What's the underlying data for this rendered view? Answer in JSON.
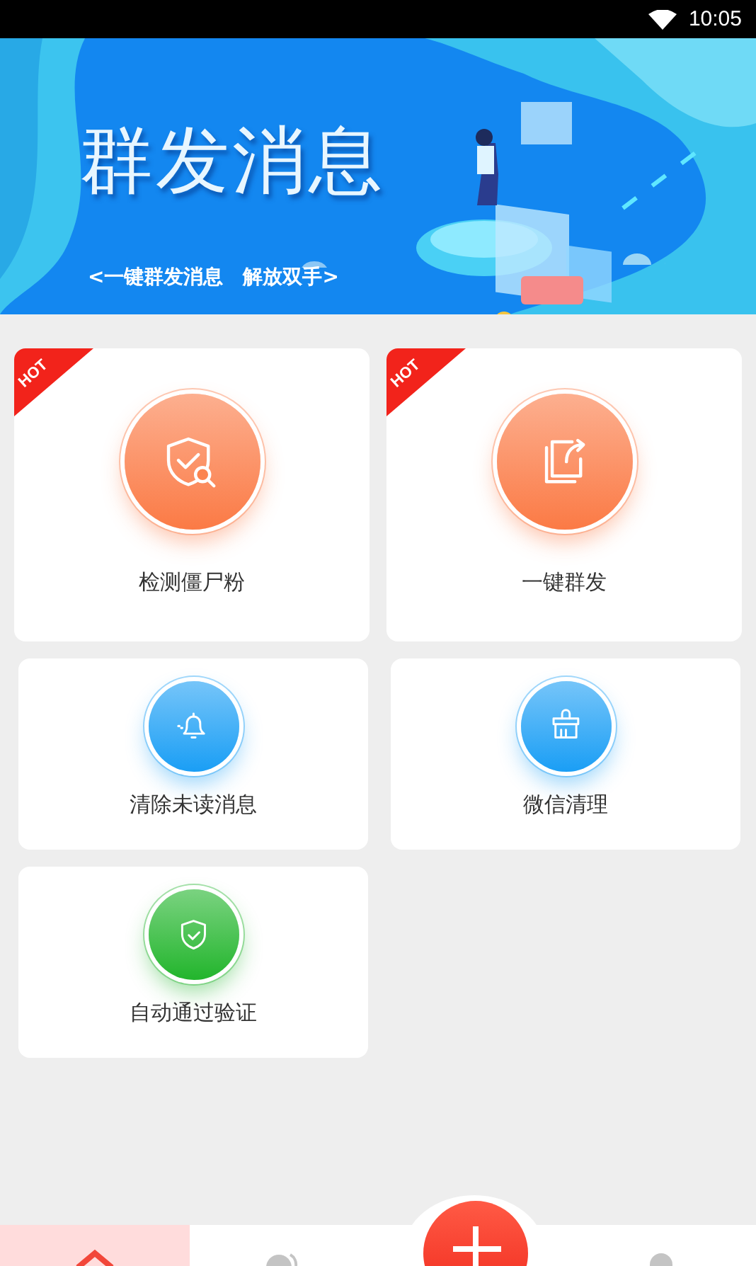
{
  "status_bar": {
    "time": "10:05"
  },
  "banner": {
    "kind": "picture",
    "title": "群发消息",
    "subtitle": "<一键群发消息　解放双手>"
  },
  "features": [
    {
      "label": "检测僵尸粉",
      "kind": "large",
      "badge": "HOT",
      "color": "#fb7a45"
    },
    {
      "label": "一键群发",
      "kind": "large",
      "badge": "HOT",
      "color": "#fb7a45"
    },
    {
      "label": "清除未读消息",
      "kind": "small",
      "color": "#1a9ef5"
    },
    {
      "label": "微信清理",
      "kind": "small",
      "color": "#1a9ef5"
    },
    {
      "label": "自动通过验证",
      "kind": "small",
      "color": "#22b52c"
    }
  ],
  "bottom_nav": [
    {
      "selected": true
    },
    {
      "selected": false
    },
    {
      "selected": false
    },
    {
      "selected": false
    }
  ]
}
